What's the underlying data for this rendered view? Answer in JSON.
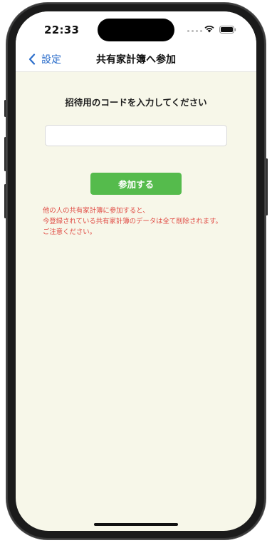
{
  "status_bar": {
    "time": "22:33",
    "icons": [
      "signal-dots",
      "wifi-icon",
      "battery-icon"
    ]
  },
  "nav": {
    "back_icon": "chevron-left-icon",
    "back_label": "設定",
    "title": "共有家計簿へ参加"
  },
  "main": {
    "prompt": "招待用のコードを入力してください",
    "code_input": {
      "value": "",
      "placeholder": ""
    },
    "join_button_label": "参加する",
    "warning_lines": [
      "他の人の共有家計簿に参加すると、",
      "今登録されている共有家計簿のデータは全て削除されます。",
      "ご注意ください。"
    ]
  },
  "colors": {
    "background": "#f7f7e9",
    "accent": "#55bb4c",
    "link": "#2c6ecb",
    "warning": "#e04a43"
  }
}
